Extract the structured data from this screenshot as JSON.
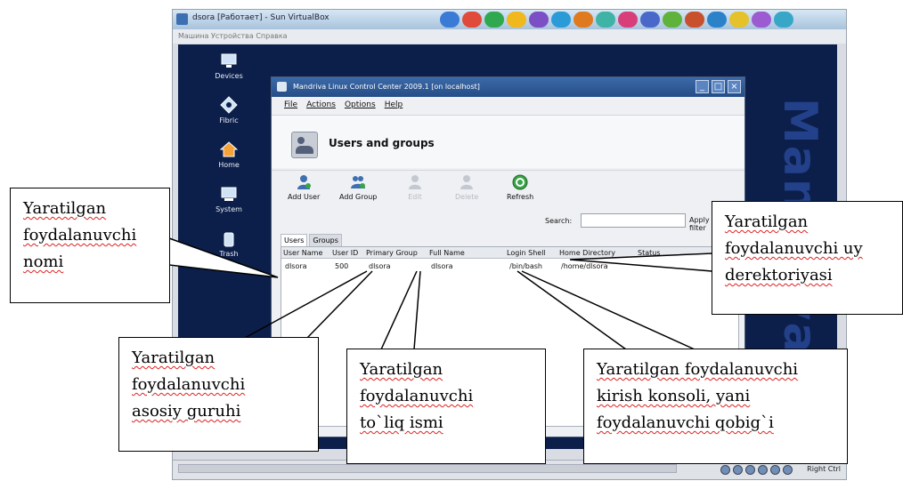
{
  "vbox": {
    "title": "dsora [Работает] - Sun VirtualBox",
    "menu": "Машина   Устройства   Справка",
    "status_right": "Right Ctrl"
  },
  "desktop": {
    "bg_text": "Mandriva",
    "icons": [
      {
        "label": "Devices",
        "icon": "computer-icon"
      },
      {
        "label": "Fibric",
        "icon": "network-icon"
      },
      {
        "label": "Home",
        "icon": "home-icon"
      },
      {
        "label": "System",
        "icon": "system-icon"
      },
      {
        "label": "Trash",
        "icon": "trash-icon"
      }
    ]
  },
  "mcc": {
    "title": "Mandriva Linux Control Center 2009.1 [on localhost]",
    "menu": [
      "File",
      "Actions",
      "Options",
      "Help"
    ],
    "header_title": "Users and groups",
    "toolbar": [
      {
        "label": "Add User",
        "icon": "add-user-icon",
        "enabled": true
      },
      {
        "label": "Add Group",
        "icon": "add-group-icon",
        "enabled": true
      },
      {
        "label": "Edit",
        "icon": "edit-icon",
        "enabled": false
      },
      {
        "label": "Delete",
        "icon": "delete-icon",
        "enabled": false
      },
      {
        "label": "Refresh",
        "icon": "refresh-icon",
        "enabled": true
      }
    ],
    "search_label": "Search:",
    "search_value": "",
    "apply_label": "Apply filter",
    "tabs": [
      "Users",
      "Groups"
    ],
    "columns": [
      "User Name",
      "User ID",
      "Primary Group",
      "Full Name",
      "Login Shell",
      "Home Directory",
      "Status"
    ],
    "rows": [
      [
        "dlsora",
        "500",
        "dlsora",
        "dlsora",
        "/bin/bash",
        "/home/dlsora",
        ""
      ]
    ]
  },
  "callouts": {
    "user_name": "Yaratilgan\nfoydalanuvchi\nnomi",
    "home_dir": "Yaratilgan\nfoydalanuvchi uy\nderektoriyasi",
    "primary_group": "Yaratilgan\nfoydalanuvchi\nasosiy guruhi",
    "full_name": "Yaratilgan\nfoydalanuvchi\nto`liq ismi",
    "login_shell": "Yaratilgan foydalanuvchi\nkirish konsoli, yani\nfoydalanuvchi qobig`i"
  },
  "colors": {
    "desktop_bg": "#0c1f4a",
    "titlebar": "#254d87",
    "callout_border": "#000000"
  }
}
